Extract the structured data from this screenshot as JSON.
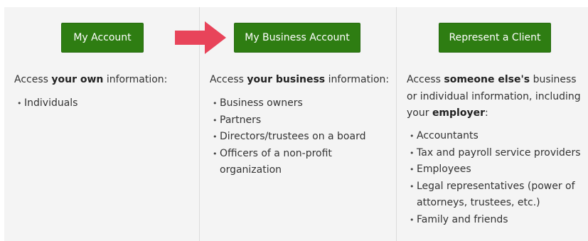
{
  "colors": {
    "button_bg": "#2e7d12",
    "button_text": "#ffffff",
    "panel_bg": "#f4f4f4",
    "arrow": "#e8445a"
  },
  "panels": [
    {
      "button_label": "My Account",
      "desc_pre": "Access ",
      "desc_bold": "your own",
      "desc_post": " information:",
      "items": [
        "Individuals"
      ]
    },
    {
      "button_label": "My Business Account",
      "desc_pre": "Access ",
      "desc_bold": "your business",
      "desc_post": " information:",
      "items": [
        "Business owners",
        "Partners",
        "Directors/trustees on a board",
        "Officers of a non-profit organization"
      ]
    },
    {
      "button_label": "Represent a Client",
      "desc_pre": "Access ",
      "desc_bold": "someone else's",
      "desc_mid": " business or individual information, including your ",
      "desc_bold2": "employer",
      "desc_post": ":",
      "items": [
        "Accountants",
        "Tax and payroll service providers",
        "Employees",
        "Legal representatives (power of attorneys, trustees, etc.)",
        "Family and friends"
      ]
    }
  ],
  "arrow_icon": "right-arrow-icon"
}
